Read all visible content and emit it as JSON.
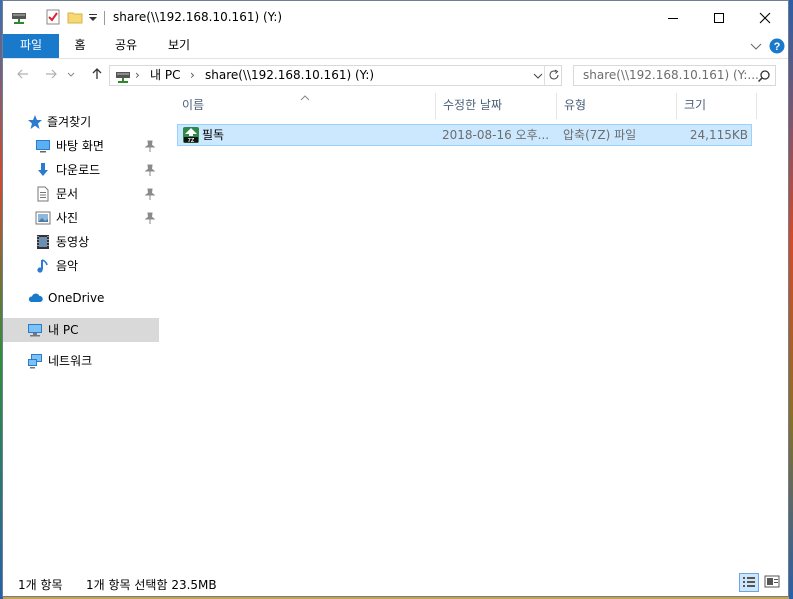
{
  "window": {
    "title": "share(\\\\192.168.10.161) (Y:)"
  },
  "colors": {
    "accent": "#1979ca",
    "selection_bg": "#cce8ff",
    "selection_border": "#99d1ff",
    "selected_nav_bg": "#d9d9d9",
    "header_text": "#4c607a"
  },
  "ribbon": {
    "tabs": [
      {
        "label": "파일",
        "active": true
      },
      {
        "label": "홈",
        "active": false
      },
      {
        "label": "공유",
        "active": false
      },
      {
        "label": "보기",
        "active": false
      }
    ]
  },
  "address": {
    "root": "내 PC",
    "current": "share(\\\\192.168.10.161) (Y:)",
    "separator": "›"
  },
  "search": {
    "placeholder": "share(\\\\192.168.10.161) (Y:..."
  },
  "sidebar": {
    "quick_access": "즐겨찾기",
    "items": [
      {
        "label": "바탕 화면",
        "icon": "desktop-icon",
        "pinned": true
      },
      {
        "label": "다운로드",
        "icon": "download-icon",
        "pinned": true
      },
      {
        "label": "문서",
        "icon": "document-icon",
        "pinned": true
      },
      {
        "label": "사진",
        "icon": "pictures-icon",
        "pinned": true
      },
      {
        "label": "동영상",
        "icon": "videos-icon",
        "pinned": false
      },
      {
        "label": "음악",
        "icon": "music-icon",
        "pinned": false
      }
    ],
    "onedrive": "OneDrive",
    "this_pc": "내 PC",
    "network": "네트워크"
  },
  "columns": {
    "name": "이름",
    "date": "수정한 날짜",
    "type": "유형",
    "size": "크기"
  },
  "files": [
    {
      "name": "필독",
      "date": "2018-08-16 오후...",
      "type": "압축(7Z) 파일",
      "size": "24,115KB",
      "selected": true
    }
  ],
  "status": {
    "count": "1개 항목",
    "selection": "1개 항목 선택함 23.5MB"
  }
}
